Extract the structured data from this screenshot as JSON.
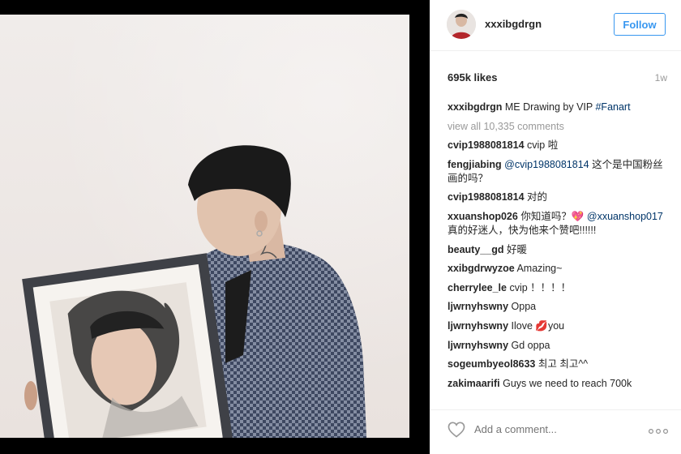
{
  "post": {
    "username": "xxxibgdrgn",
    "follow_label": "Follow",
    "likes": "695k likes",
    "time": "1w",
    "caption": {
      "user": "xxxibgdrgn",
      "text": "ME Drawing by VIP ",
      "hashtag": "#Fanart"
    },
    "view_all": "view all 10,335 comments",
    "add_comment_placeholder": "Add a comment..."
  },
  "comments": [
    {
      "user": "cvip1988081814",
      "text": "cvip 啦"
    },
    {
      "user": "fengjiabing",
      "mention": "@cvip1988081814",
      "text": " 这个是中国粉丝画的吗？"
    },
    {
      "user": "cvip1988081814",
      "text": "对的"
    },
    {
      "user": "xxuanshop026",
      "text": "你知道吗？💖 ",
      "mention": "@xxuanshop017",
      "text2": " 真的好迷人，快为他来个赞吧!!!!!!"
    },
    {
      "user": "beauty__gd",
      "text": "好暖"
    },
    {
      "user": "xxibgdrwyzoe",
      "text": "Amazing~"
    },
    {
      "user": "cherrylee_le",
      "text": "cvip ！！！！"
    },
    {
      "user": "ljwrnyhswny",
      "text": "Oppa"
    },
    {
      "user": "ljwrnyhswny",
      "text": "Ilove 💋you"
    },
    {
      "user": "ljwrnyhswny",
      "text": "Gd oppa"
    },
    {
      "user": "sogeumbyeol8633",
      "text": "최고 최고^^"
    },
    {
      "user": "zakimaarifi",
      "text": "Guys we need to reach 700k"
    }
  ],
  "icons": {
    "like": "heart-icon",
    "more": "more-options-icon",
    "avatar": "avatar"
  },
  "colors": {
    "link": "#003569",
    "follow": "#3897f0",
    "muted": "#999999"
  }
}
